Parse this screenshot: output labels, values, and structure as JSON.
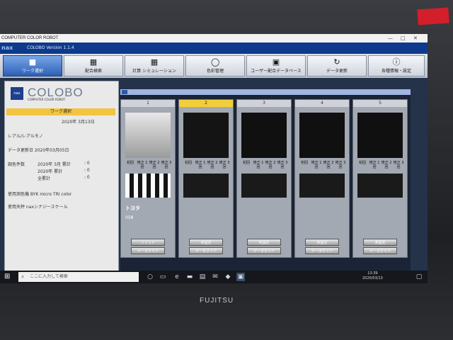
{
  "window": {
    "title": "COMPUTER COLOR ROBOT",
    "min": "—",
    "max": "□",
    "close": "✕"
  },
  "app": {
    "logo": "nax",
    "version": "COLOBO Version 1.1.4"
  },
  "red_tag": "",
  "toolbar": [
    {
      "label": "ワーク選択",
      "icon": "■",
      "active": true
    },
    {
      "label": "配合検索",
      "icon": "▦"
    },
    {
      "label": "計算 シミュレーション",
      "icon": "▦"
    },
    {
      "label": "色彩管理",
      "icon": "◯"
    },
    {
      "label": "ユーザー配合データベース",
      "icon": "▣"
    },
    {
      "label": "データ更新",
      "icon": "↻"
    },
    {
      "label": "各種情報・設定",
      "icon": "ⓘ"
    }
  ],
  "left": {
    "brand_box": "nax",
    "brand_name": "COLOBO",
    "brand_sub": "COMPUTER COLOR ROBOT",
    "work_title": "ワーク選択",
    "date": "2020年 3月13日",
    "type": "レアル/レアルモノ",
    "data_update": "データ更新日 2020年03月05日",
    "count_label": "調色件数",
    "counts": [
      {
        "label": "2020年 3月 累計",
        "value": ": 0"
      },
      {
        "label": "2020年 累計",
        "value": ": 0"
      },
      {
        "label": "全累計",
        "value": ": 0"
      }
    ],
    "device": "使用測色機 BYK micro TRI color",
    "scale": "使用天秤 naxシナジースケール"
  },
  "cards": [
    {
      "num": "1",
      "maker": "トヨタ",
      "code": "058",
      "btn1": "ソリッド",
      "btn2": "データクリア"
    },
    {
      "num": "2",
      "maker": "",
      "code": "",
      "btn1": "未設定",
      "btn2": "データクリア"
    },
    {
      "num": "3",
      "maker": "",
      "code": "",
      "btn1": "未設定",
      "btn2": "データクリア"
    },
    {
      "num": "4",
      "maker": "",
      "code": "",
      "btn1": "未設定",
      "btn2": "データクリア"
    },
    {
      "num": "5",
      "maker": "",
      "code": "",
      "btn1": "未設定",
      "btn2": "データクリア"
    }
  ],
  "card_labels": [
    "初回",
    "修正 1回",
    "修正 2回",
    "修正 3回"
  ],
  "taskbar": {
    "search_placeholder": "ここに入力して検索",
    "time": "13:39",
    "date": "2020/03/13"
  },
  "laptop_brand": "FUJITSU"
}
